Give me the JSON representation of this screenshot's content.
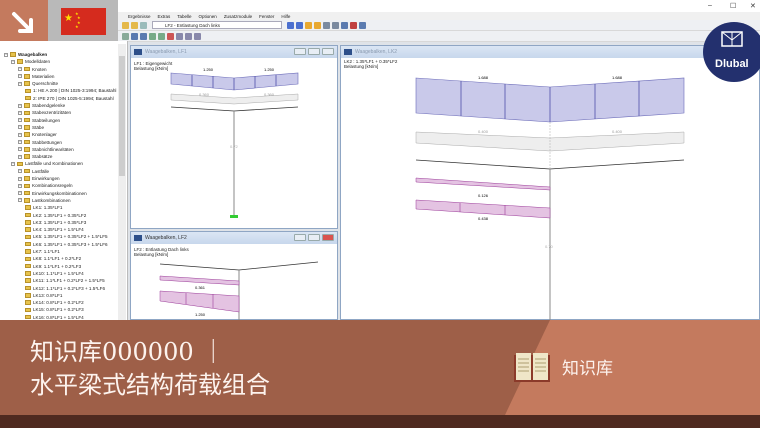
{
  "app": {
    "menu": [
      "Ergebnisse",
      "Extras",
      "Tabelle",
      "Optionen",
      "Zusatzmodule",
      "Fenster",
      "Hilfe"
    ],
    "loadcase_combo": "LF2 - Entlastung Dach links",
    "window_controls": [
      "–",
      "☐",
      "✕"
    ]
  },
  "navigator": {
    "root": "Waagebalken",
    "items": [
      {
        "label": "Modelldaten",
        "level": 1
      },
      {
        "label": "Knoten",
        "level": 2
      },
      {
        "label": "Materialien",
        "level": 2
      },
      {
        "label": "Querschnitte",
        "level": 2
      },
      {
        "label": "1: HE A 200 | DIN 1025-3:1994; Baustahl",
        "level": 3
      },
      {
        "label": "2: IPE 270 | DIN 1025-5:1994; Baustahl",
        "level": 3
      },
      {
        "label": "Stabendgelenke",
        "level": 2
      },
      {
        "label": "Stabexzentrizitäten",
        "level": 2
      },
      {
        "label": "Stabteilungen",
        "level": 2
      },
      {
        "label": "Stäbe",
        "level": 2
      },
      {
        "label": "Knotenlager",
        "level": 2
      },
      {
        "label": "Stabbettungen",
        "level": 2
      },
      {
        "label": "Stabnichtlinearitäten",
        "level": 2
      },
      {
        "label": "Stabsätze",
        "level": 2
      },
      {
        "label": "Lastfälle und Kombinationen",
        "level": 1
      },
      {
        "label": "Lastfälle",
        "level": 2
      },
      {
        "label": "Einwirkungen",
        "level": 2
      },
      {
        "label": "Kombinationsregeln",
        "level": 2
      },
      {
        "label": "Einwirkungskombinationen",
        "level": 2
      },
      {
        "label": "Lastkombinationen",
        "level": 2
      },
      {
        "label": "LK1: 1.35*LF1",
        "level": 3
      },
      {
        "label": "LK2: 1.35*LF1 + 0.35*LF2",
        "level": 3
      },
      {
        "label": "LK3: 1.35*LF1 + 0.35*LF3",
        "level": 3
      },
      {
        "label": "LK4: 1.35*LF1 + 1.5*LF4",
        "level": 3
      },
      {
        "label": "LK5: 1.35*LF1 + 0.35*LF2 + 1.5*LF5",
        "level": 3
      },
      {
        "label": "LK6: 1.35*LF1 + 0.35*LF3 + 1.5*LF6",
        "level": 3
      },
      {
        "label": "LK7: 1.1*LF1",
        "level": 3
      },
      {
        "label": "LK8: 1.1*LF1 + 0.2*LF2",
        "level": 3
      },
      {
        "label": "LK9: 1.1*LF1 + 0.2*LF3",
        "level": 3
      },
      {
        "label": "LK10: 1.1*LF1 + 1.5*LF4",
        "level": 3
      },
      {
        "label": "LK11: 1.1*LF1 + 0.2*LF2 + 1.5*LF5",
        "level": 3
      },
      {
        "label": "LK12: 1.1*LF1 + 0.2*LF3 + 1.5*LF6",
        "level": 3
      },
      {
        "label": "LK13: 0.8*LF1",
        "level": 3
      },
      {
        "label": "LK14: 0.8*LF1 + 0.2*LF2",
        "level": 3
      },
      {
        "label": "LK15: 0.8*LF1 + 0.2*LF3",
        "level": 3
      },
      {
        "label": "LK16: 0.8*LF1 + 1.5*LF4",
        "level": 3
      }
    ]
  },
  "views": {
    "lf1": {
      "title": "Waagebalken, LF1",
      "line1": "LF1 : Eigengewicht",
      "line2": "Belastung [kN/m]",
      "load_top": "1.250",
      "load_mid": "0.360",
      "col": "0.72"
    },
    "lf2": {
      "title": "Waagebalken, LF2",
      "line1": "LF2 : Entlastung Dach links",
      "line2": "Belastung [kN/m]",
      "load1": "0.361",
      "load2": "1.250"
    },
    "lk2": {
      "title": "Waagebalken, LK2",
      "line1": "LK2 : 1.35*LF1 + 0.35*LF2",
      "line2": "Belastung [kN/m]",
      "load_top": "1.688",
      "load_mid": "0.400",
      "load_p1": "0.126",
      "load_p2": "0.438",
      "col": "0.70"
    }
  },
  "logo": {
    "text": "Dlubal"
  },
  "banner": {
    "title_line1": "知识库000000 ｜",
    "title_line2": "水平梁式结构荷载组合",
    "section": "知识库"
  },
  "colors": {
    "banner": "#9e5f48",
    "banner_light": "#c47a5e",
    "load_blue": "#c9c9ea",
    "load_pink": "#e4c3e2"
  }
}
